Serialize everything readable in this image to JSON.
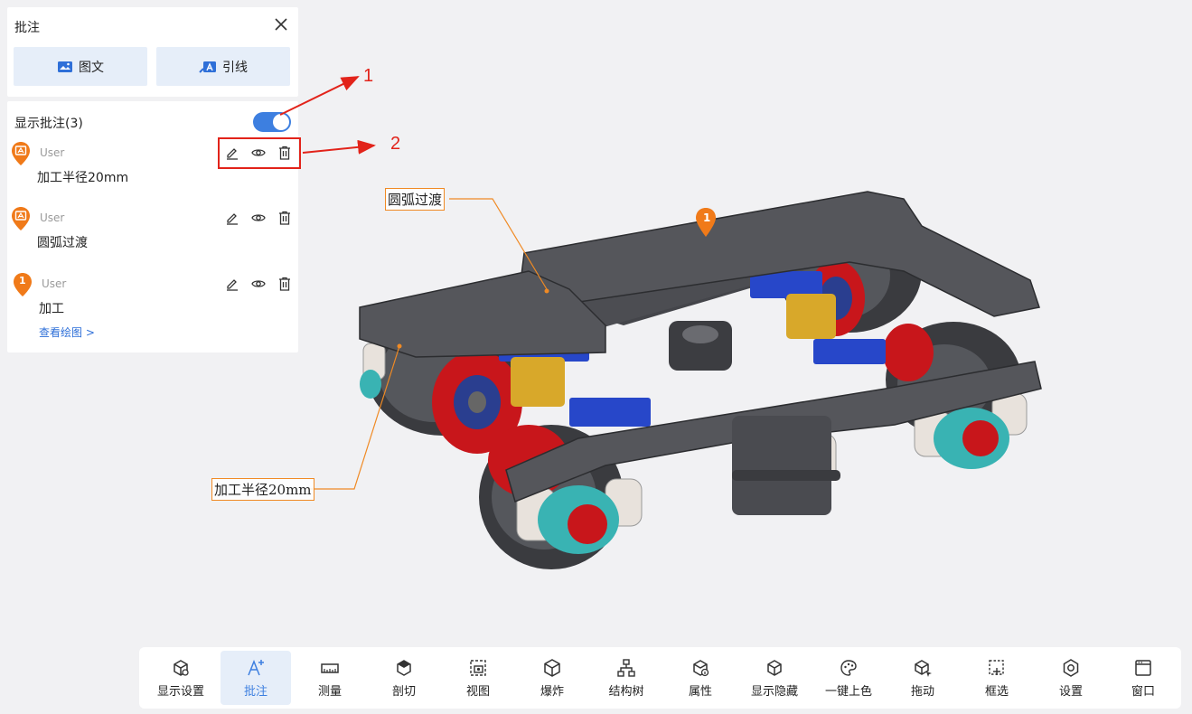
{
  "panel": {
    "title": "批注",
    "mode_buttons": {
      "image_text": "图文",
      "leader": "引线"
    },
    "show_label": "显示批注(3)",
    "toggle_on": true,
    "items": [
      {
        "user": "User",
        "text": "加工半径20mm",
        "pin": "camera-pin-icon"
      },
      {
        "user": "User",
        "text": "圆弧过渡",
        "pin": "camera-pin-icon"
      },
      {
        "user": "User",
        "text": "加工",
        "pin": "numbered-pin-icon",
        "pin_number": "1",
        "link": "查看绘图 >"
      }
    ]
  },
  "callouts": {
    "one": "1",
    "two": "2"
  },
  "model_labels": {
    "radius": "加工半径20mm",
    "arc": "圆弧过渡",
    "pin_number": "1"
  },
  "toolbar": [
    {
      "label": "显示设置",
      "icon": "cube-gear-icon"
    },
    {
      "label": "批注",
      "icon": "annotation-icon",
      "active": true
    },
    {
      "label": "测量",
      "icon": "ruler-icon"
    },
    {
      "label": "剖切",
      "icon": "section-cube-icon"
    },
    {
      "label": "视图",
      "icon": "view-icon"
    },
    {
      "label": "爆炸",
      "icon": "explode-icon"
    },
    {
      "label": "结构树",
      "icon": "tree-icon"
    },
    {
      "label": "属性",
      "icon": "info-cube-icon"
    },
    {
      "label": "显示隐藏",
      "icon": "visibility-cube-icon"
    },
    {
      "label": "一键上色",
      "icon": "palette-icon"
    },
    {
      "label": "拖动",
      "icon": "move-cube-icon"
    },
    {
      "label": "框选",
      "icon": "box-select-icon"
    },
    {
      "label": "设置",
      "icon": "settings-icon"
    },
    {
      "label": "窗口",
      "icon": "window-icon"
    }
  ],
  "colors": {
    "accent": "#3d7fe0",
    "callout_red": "#e2231a",
    "label_orange": "#f08a24",
    "pin_orange": "#f07a19"
  }
}
